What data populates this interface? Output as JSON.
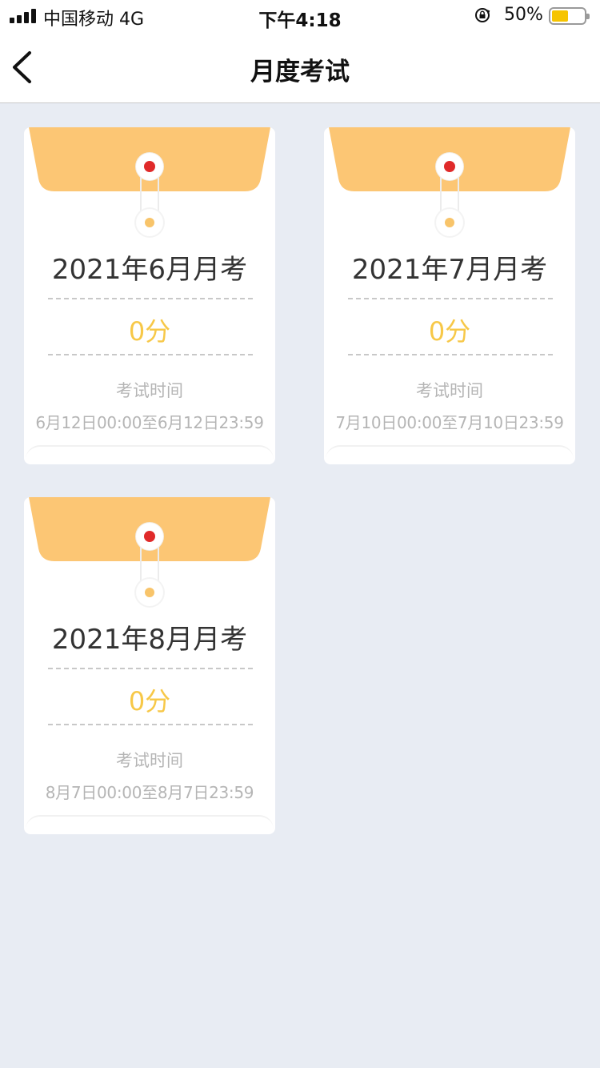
{
  "status_bar": {
    "carrier": "中国移动   4G",
    "time": "下午4:18",
    "battery_percent": "50%",
    "battery_level": 0.5,
    "battery_color": "#f6c400"
  },
  "nav": {
    "back_icon": "chevron-left-icon",
    "title": "月度考试"
  },
  "colors": {
    "flap": "#fcc674",
    "score": "#f7c848",
    "pin_red": "#e02a2a",
    "background": "#e8ecf3"
  },
  "exams": [
    {
      "title": "2021年6月月考",
      "score": "0分",
      "time_label": "考试时间",
      "time_range": "6月12日00:00至6月12日23:59"
    },
    {
      "title": "2021年7月月考",
      "score": "0分",
      "time_label": "考试时间",
      "time_range": "7月10日00:00至7月10日23:59"
    },
    {
      "title": "2021年8月月考",
      "score": "0分",
      "time_label": "考试时间",
      "time_range": "8月7日00:00至8月7日23:59"
    }
  ]
}
